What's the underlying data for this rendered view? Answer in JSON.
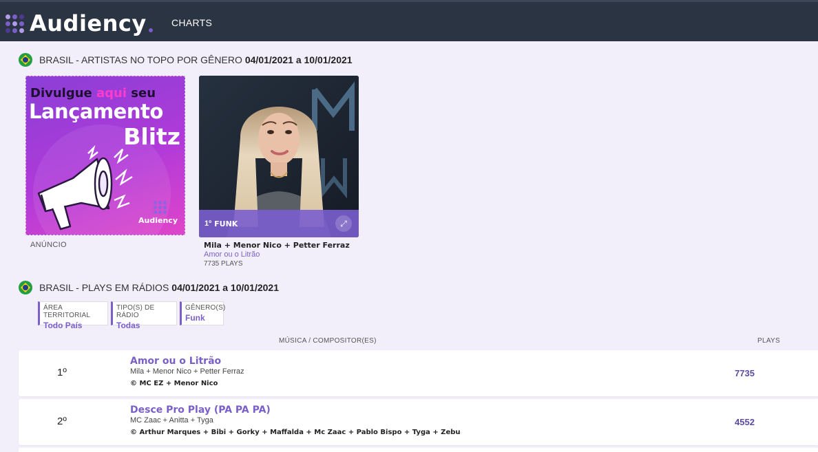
{
  "header": {
    "brand": "Audiency",
    "nav_charts": "CHARTS"
  },
  "section1": {
    "title": "BRASIL - ARTISTAS NO TOPO POR GÊNERO",
    "date_range": "04/01/2021 a 10/01/2021"
  },
  "ad": {
    "line1_a": "Divulgue ",
    "line1_hl": "aqui",
    "line1_b": " seu",
    "line2": "Lançamento",
    "line3": "Blitz",
    "brand": "Audiency",
    "label": "ANÚNCIO"
  },
  "artist_card": {
    "rank": "1º",
    "genre": "FUNK",
    "artists": "Mila + Menor Nico + Petter Ferraz",
    "song": "Amor ou o Litrão",
    "plays": "7735 PLAYS"
  },
  "section2": {
    "title": "BRASIL - PLAYS EM RÁDIOS",
    "date_range": "04/01/2021 a 10/01/2021"
  },
  "filters": [
    {
      "label": "ÁREA TERRITORIAL",
      "value": "Todo País"
    },
    {
      "label": "TIPO(S) DE RÁDIO",
      "value": "Todas"
    },
    {
      "label": "GÊNERO(S)",
      "value": "Funk"
    }
  ],
  "table": {
    "col_music": "MÚSICA / COMPOSITOR(ES)",
    "col_plays": "PLAYS",
    "rows": [
      {
        "rank": "1º",
        "title": "Amor ou o Litrão",
        "artists": "Mila + Menor Nico + Petter Ferraz",
        "composers": "© MC EZ + Menor Nico",
        "plays": "7735"
      },
      {
        "rank": "2º",
        "title": "Desce Pro Play (PA PA PA)",
        "artists": "MC Zaac + Anitta + Tyga",
        "composers": "© Arthur Marques + Bibi + Gorky + Maffalda + Mc Zaac + Pablo Bispo + Tyga + Zebu",
        "plays": "4552"
      }
    ]
  },
  "colors": {
    "accent": "#7b5fc9",
    "topbar": "#2a3442",
    "background": "#f2eefa"
  }
}
